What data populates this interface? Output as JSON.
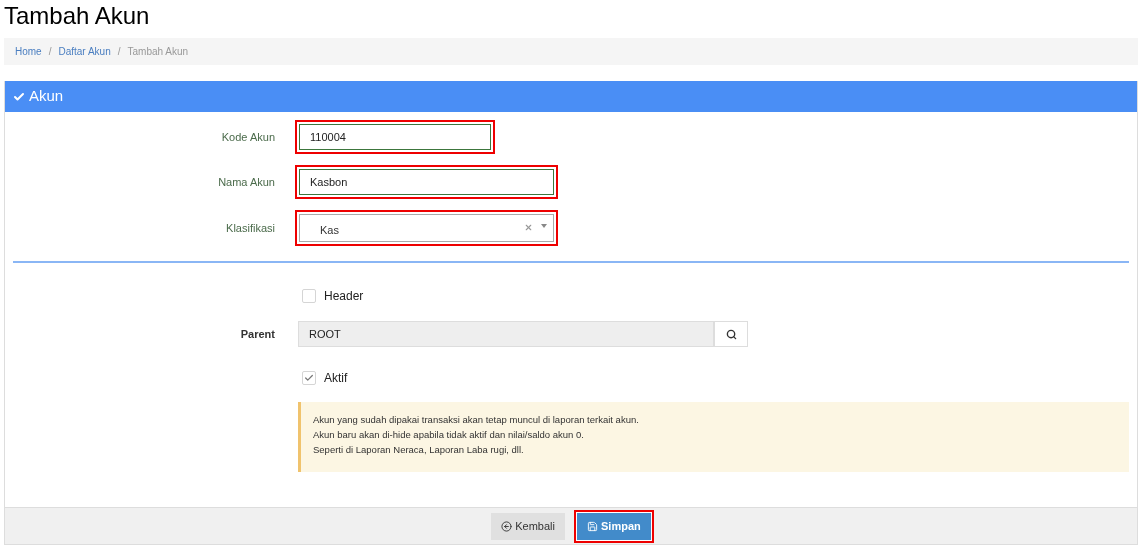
{
  "page_title": "Tambah Akun",
  "breadcrumb_separator": "/",
  "breadcrumb": [
    {
      "label": "Home",
      "selected": false
    },
    {
      "label": "Daftar Akun",
      "selected": false
    },
    {
      "label": "Tambah Akun",
      "selected": true
    }
  ],
  "panel": {
    "title": "Akun",
    "fields": [
      {
        "label": "Kode Akun",
        "value": "110004",
        "kind": "text",
        "highlighted": true
      },
      {
        "label": "Nama Akun",
        "value": "Kasbon",
        "kind": "text",
        "highlighted": true
      },
      {
        "label": "Klasifikasi",
        "value": "Kas",
        "kind": "select",
        "highlighted": true
      }
    ],
    "header_checkbox": {
      "label": "Header",
      "checked": false
    },
    "parent": {
      "label": "Parent",
      "value": "ROOT"
    },
    "aktif_checkbox": {
      "label": "Aktif",
      "checked": true
    },
    "note": [
      "Akun yang sudah dipakai transaksi akan tetap muncul di laporan terkait akun.",
      "Akun baru akan di-hide apabila tidak aktif dan nilai/saldo akun 0.",
      "Seperti di Laporan Neraca, Laporan Laba rugi, dll."
    ],
    "buttons": [
      {
        "label": "Kembali",
        "kind": "back",
        "highlighted": false
      },
      {
        "label": "Simpan",
        "kind": "save",
        "highlighted": true
      }
    ]
  }
}
